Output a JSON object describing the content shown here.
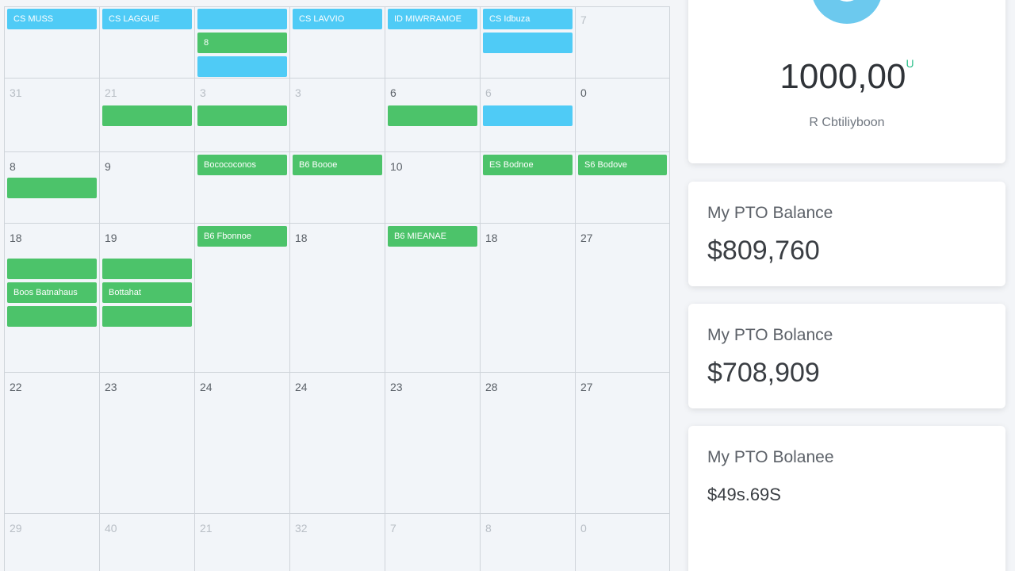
{
  "calendar": {
    "rows": [
      {
        "height": 90,
        "cells": [
          {
            "day": "",
            "events": [
              {
                "text": "CS MUSS",
                "color": "blue"
              }
            ]
          },
          {
            "day": "",
            "events": [
              {
                "text": "CS LAGGUE",
                "color": "blue"
              }
            ]
          },
          {
            "day": "",
            "events": [
              {
                "text": "",
                "color": "blue"
              },
              {
                "text": "8",
                "color": "green"
              },
              {
                "text": "",
                "color": "blue"
              }
            ]
          },
          {
            "day": "",
            "events": [
              {
                "text": "CS LAVVIO",
                "color": "blue"
              }
            ]
          },
          {
            "day": "",
            "events": [
              {
                "text": "ID MIWRRAMOE",
                "color": "blue"
              }
            ]
          },
          {
            "day": "",
            "events": [
              {
                "text": "CS Idbuza",
                "color": "blue"
              },
              {
                "text": "",
                "color": "blue"
              }
            ]
          },
          {
            "day": "7",
            "faint": true,
            "events": []
          }
        ]
      },
      {
        "height": 93,
        "cells": [
          {
            "day": "31",
            "faint": true,
            "events": []
          },
          {
            "day": "21",
            "faint": true,
            "events": [
              {
                "text": "",
                "color": "green"
              }
            ]
          },
          {
            "day": "3",
            "faint": true,
            "events": [
              {
                "text": "",
                "color": "green"
              }
            ]
          },
          {
            "day": "3",
            "faint": true,
            "events": []
          },
          {
            "day": "6",
            "events": [
              {
                "text": "",
                "color": "green"
              }
            ]
          },
          {
            "day": "6",
            "faint": true,
            "events": [
              {
                "text": "",
                "color": "blue"
              }
            ]
          },
          {
            "day": "0",
            "events": []
          }
        ]
      },
      {
        "height": 90,
        "cells": [
          {
            "day": "8",
            "events": [
              {
                "text": "",
                "color": "green"
              }
            ]
          },
          {
            "day": "9",
            "events": []
          },
          {
            "day": "",
            "events": [
              {
                "text": "Bocococonos",
                "color": "green"
              }
            ]
          },
          {
            "day": "",
            "events": [
              {
                "text": "B6 Boooe",
                "color": "green"
              }
            ]
          },
          {
            "day": "10",
            "events": []
          },
          {
            "day": "",
            "events": [
              {
                "text": "ES Bodnoe",
                "color": "green"
              }
            ]
          },
          {
            "day": "",
            "events": [
              {
                "text": "S6 Bodove",
                "color": "green"
              }
            ]
          }
        ]
      },
      {
        "height": 188,
        "cells": [
          {
            "day": "18",
            "events": [
              {
                "text": "",
                "color": "green"
              },
              {
                "text": "Boos Batnahaus",
                "color": "green"
              },
              {
                "text": "",
                "color": "green"
              }
            ]
          },
          {
            "day": "19",
            "events": [
              {
                "text": "",
                "color": "green"
              },
              {
                "text": "Bottahat",
                "color": "green"
              },
              {
                "text": "",
                "color": "green"
              }
            ]
          },
          {
            "day": "",
            "events": [
              {
                "text": "B6 Fbonnoe",
                "color": "green"
              }
            ]
          },
          {
            "day": "18",
            "events": []
          },
          {
            "day": "",
            "events": [
              {
                "text": "B6 MIEANAE",
                "color": "green"
              }
            ]
          },
          {
            "day": "18",
            "events": []
          },
          {
            "day": "27",
            "events": []
          }
        ]
      },
      {
        "height": 178,
        "cells": [
          {
            "day": "22",
            "events": []
          },
          {
            "day": "23",
            "events": []
          },
          {
            "day": "24",
            "events": []
          },
          {
            "day": "24",
            "events": []
          },
          {
            "day": "23",
            "events": []
          },
          {
            "day": "28",
            "events": []
          },
          {
            "day": "27",
            "events": []
          }
        ]
      },
      {
        "height": 80,
        "cells": [
          {
            "day": "29",
            "faint": true,
            "events": []
          },
          {
            "day": "40",
            "faint": true,
            "events": []
          },
          {
            "day": "21",
            "faint": true,
            "events": []
          },
          {
            "day": "32",
            "faint": true,
            "events": []
          },
          {
            "day": "7",
            "faint": true,
            "events": []
          },
          {
            "day": "8",
            "faint": true,
            "events": []
          },
          {
            "day": "0",
            "faint": true,
            "events": []
          }
        ]
      }
    ]
  },
  "summary": {
    "value": "1000,00",
    "unit": "U",
    "label": "R Cbtiliyboon"
  },
  "pto_cards": [
    {
      "title": "My PTO Balance",
      "value": "$809,760"
    },
    {
      "title": "My PTO Bolance",
      "value": "$708,909"
    },
    {
      "title": "My PTO Bolanee",
      "value": "$49s.69S"
    }
  ],
  "colors": {
    "event_green": "#4cc36a",
    "event_blue": "#4fcbf6",
    "avatar_blue": "#6cc9ee"
  }
}
